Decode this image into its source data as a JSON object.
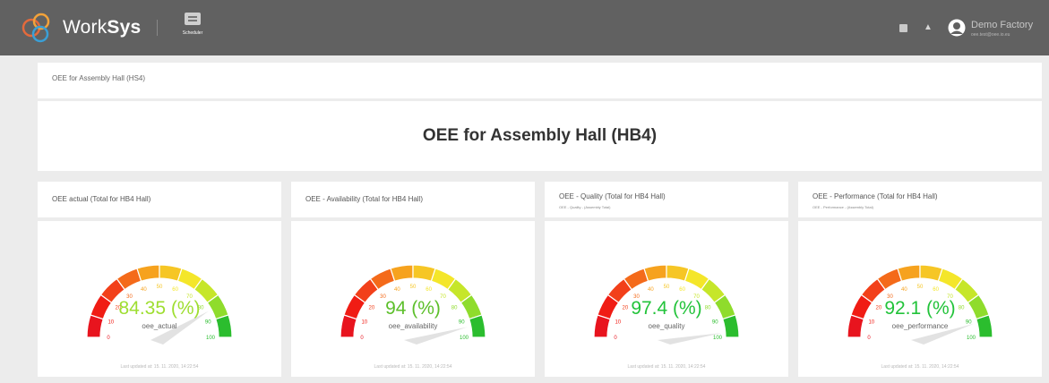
{
  "app": {
    "brand_prefix": "Work",
    "brand_suffix": "Sys",
    "scheduler_label": "Scheduler",
    "user_name": "Demo Factory",
    "user_email": "oee.test@oee.io.eu"
  },
  "page": {
    "header_title": "OEE for Assembly Hall (HS4)",
    "main_title": "OEE for Assembly Hall (HB4)"
  },
  "gauges": [
    {
      "title": "OEE actual (Total for HB4 Hall)",
      "subtitle": "",
      "value": 84.35,
      "value_text": "84.35 (%)",
      "metric_label": "oee_actual",
      "value_color": "#9ede30",
      "updated": "Last updated at: 15. 11. 2020, 14:22:54"
    },
    {
      "title": "OEE - Availability (Total for HB4 Hall)",
      "subtitle": "",
      "value": 94,
      "value_text": "94 (%)",
      "metric_label": "oee_availability",
      "value_color": "#5cbf2a",
      "updated": "Last updated at: 15. 11. 2020, 14:22:54"
    },
    {
      "title": "OEE - Quality (Total for HB4 Hall)",
      "subtitle": "OEE - Quality - (Assembly Total)",
      "value": 97.4,
      "value_text": "97.4 (%)",
      "metric_label": "oee_quality",
      "value_color": "#22c33a",
      "updated": "Last updated at: 15. 11. 2020, 14:22:54"
    },
    {
      "title": "OEE - Performance (Total for HB4 Hall)",
      "subtitle": "OEE - Performance - (Assembly Total)",
      "value": 92.1,
      "value_text": "92.1 (%)",
      "metric_label": "oee_performance",
      "value_color": "#22c33a",
      "updated": "Last updated at: 15. 11. 2020, 14:22:54"
    }
  ],
  "gauge_scale": {
    "min": 0,
    "max": 100,
    "ticks": [
      "0",
      "10",
      "20",
      "30",
      "40",
      "50",
      "60",
      "70",
      "80",
      "90",
      "100"
    ]
  },
  "colors": {
    "topbar": "#616161",
    "page_bg": "#ececec",
    "card_bg": "#ffffff"
  },
  "icons": [
    "worksys-logo-icon",
    "calendar-icon",
    "notes-icon",
    "bell-icon",
    "user-avatar-icon"
  ]
}
